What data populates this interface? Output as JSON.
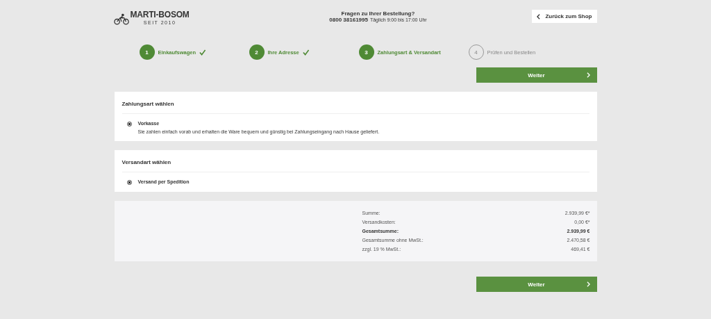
{
  "header": {
    "logo": {
      "name": "MARTI-BOSOM",
      "since": "SEIT 2010"
    },
    "contact": {
      "question": "Fragen zu Ihrer Bestellung?",
      "phone": "0800 38161995",
      "hours": "Täglich 9:00 bis 17:00 Uhr"
    },
    "back_button": "Zurück zum Shop"
  },
  "steps": [
    {
      "number": "1",
      "label": "Einkaufswagen",
      "kind": "done"
    },
    {
      "number": "2",
      "label": "Ihre Adresse",
      "kind": "done"
    },
    {
      "number": "3",
      "label": "Zahlungsart & Versandart",
      "kind": "current"
    },
    {
      "number": "4",
      "label": "Prüfen und Bestellen",
      "kind": "pending"
    }
  ],
  "next_button_top": "Weiter",
  "payment": {
    "title": "Zahlungsart wählen",
    "options": [
      {
        "label": "Vorkasse",
        "description": "Sie zahlen einfach vorab und erhalten die Ware bequem und günstig bei Zahlungseingang nach Hause geliefert.",
        "selected": true
      }
    ]
  },
  "shipping": {
    "title": "Versandart wählen",
    "options": [
      {
        "label": "Versand per Spedition",
        "selected": true
      }
    ]
  },
  "summary": [
    {
      "label": "Summe:",
      "value": "2.939,99 €*",
      "kind": "normal"
    },
    {
      "label": "Versandkosten:",
      "value": "0,00 €*",
      "kind": "normal"
    },
    {
      "label": "Gesamtsumme:",
      "value": "2.939,99 €",
      "kind": "total"
    },
    {
      "label": "Gesamtsumme ohne MwSt.:",
      "value": "2.470,58 €",
      "kind": "small"
    },
    {
      "label": "zzgl. 19 % MwSt.:",
      "value": "469,41 €",
      "kind": "small"
    }
  ],
  "next_button_bottom": "Weiter"
}
